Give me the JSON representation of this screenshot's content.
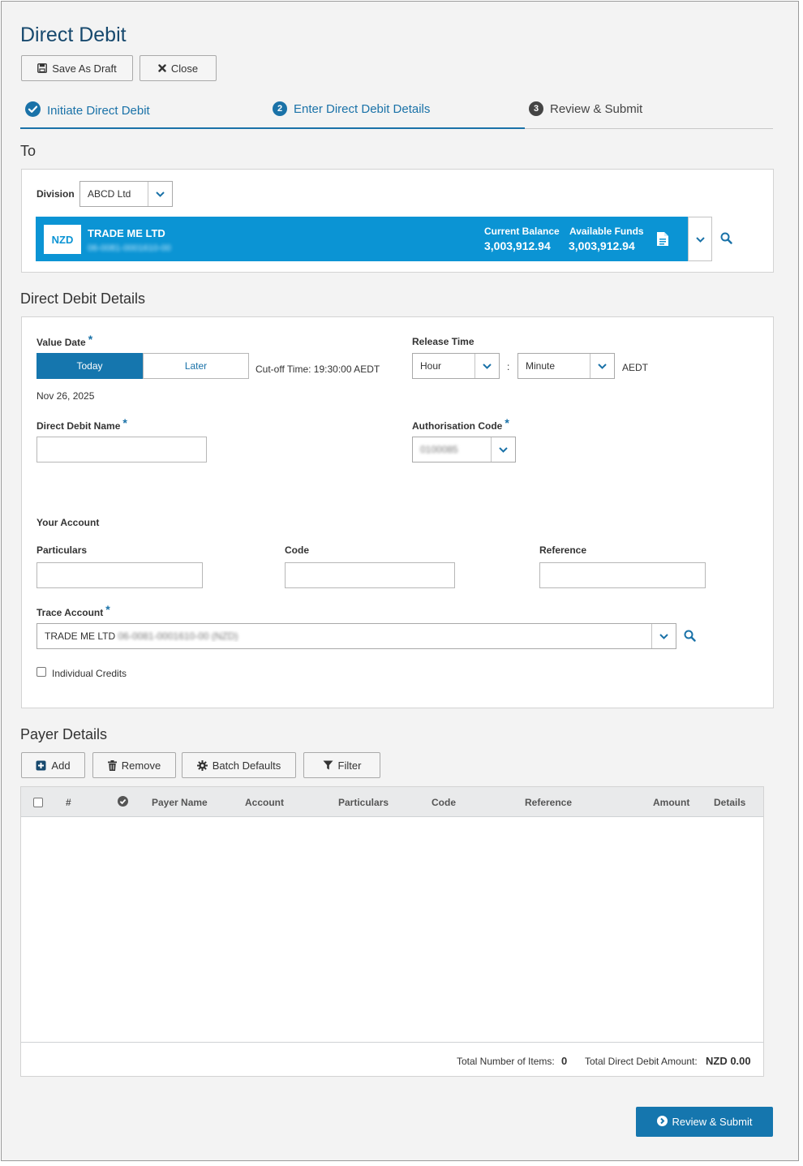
{
  "page": {
    "title": "Direct Debit"
  },
  "toolbar": {
    "save_draft_label": "Save As Draft",
    "close_label": "Close"
  },
  "steps": [
    {
      "label": "Initiate Direct Debit",
      "state": "completed"
    },
    {
      "number": "2",
      "label": "Enter Direct Debit Details",
      "state": "active"
    },
    {
      "number": "3",
      "label": "Review & Submit",
      "state": "upcoming"
    }
  ],
  "to_section": {
    "title": "To",
    "division_label": "Division",
    "division_value": "ABCD Ltd",
    "account": {
      "currency": "NZD",
      "name": "TRADE ME LTD",
      "number": "06-0081-0001610-00",
      "current_balance_label": "Current Balance",
      "current_balance": "3,003,912.94",
      "available_funds_label": "Available Funds",
      "available_funds": "3,003,912.94"
    }
  },
  "details": {
    "title": "Direct Debit Details",
    "value_date_label": "Value Date",
    "today_label": "Today",
    "later_label": "Later",
    "cutoff_text": "Cut-off Time: 19:30:00 AEDT",
    "date_text": "Nov 26, 2025",
    "release_time_label": "Release Time",
    "hour_value": "Hour",
    "colon": ":",
    "minute_value": "Minute",
    "tz": "AEDT",
    "dd_name_label": "Direct Debit Name",
    "dd_name_value": "",
    "auth_code_label": "Authorisation Code",
    "auth_code_value": "0100085",
    "your_account_label": "Your Account",
    "particulars_label": "Particulars",
    "code_label": "Code",
    "reference_label": "Reference",
    "trace_account_label": "Trace Account",
    "trace_account_name": "TRADE ME LTD",
    "trace_account_number": "06-0081-0001610-00 (NZD)",
    "individual_credits_label": "Individual Credits"
  },
  "payer": {
    "title": "Payer Details",
    "add_label": "Add",
    "remove_label": "Remove",
    "batch_defaults_label": "Batch Defaults",
    "filter_label": "Filter",
    "columns": [
      "#",
      "Payer Name",
      "Account",
      "Particulars",
      "Code",
      "Reference",
      "Amount",
      "Details"
    ],
    "total_items_label": "Total Number of Items:",
    "total_items_value": "0",
    "total_amount_label": "Total Direct Debit Amount:",
    "total_amount_value": "NZD 0.00"
  },
  "footer": {
    "review_submit_label": "Review & Submit"
  },
  "colors": {
    "primary": "#1576ae",
    "card": "#0b94d4",
    "title": "#17496e",
    "step_dark": "#444444"
  }
}
